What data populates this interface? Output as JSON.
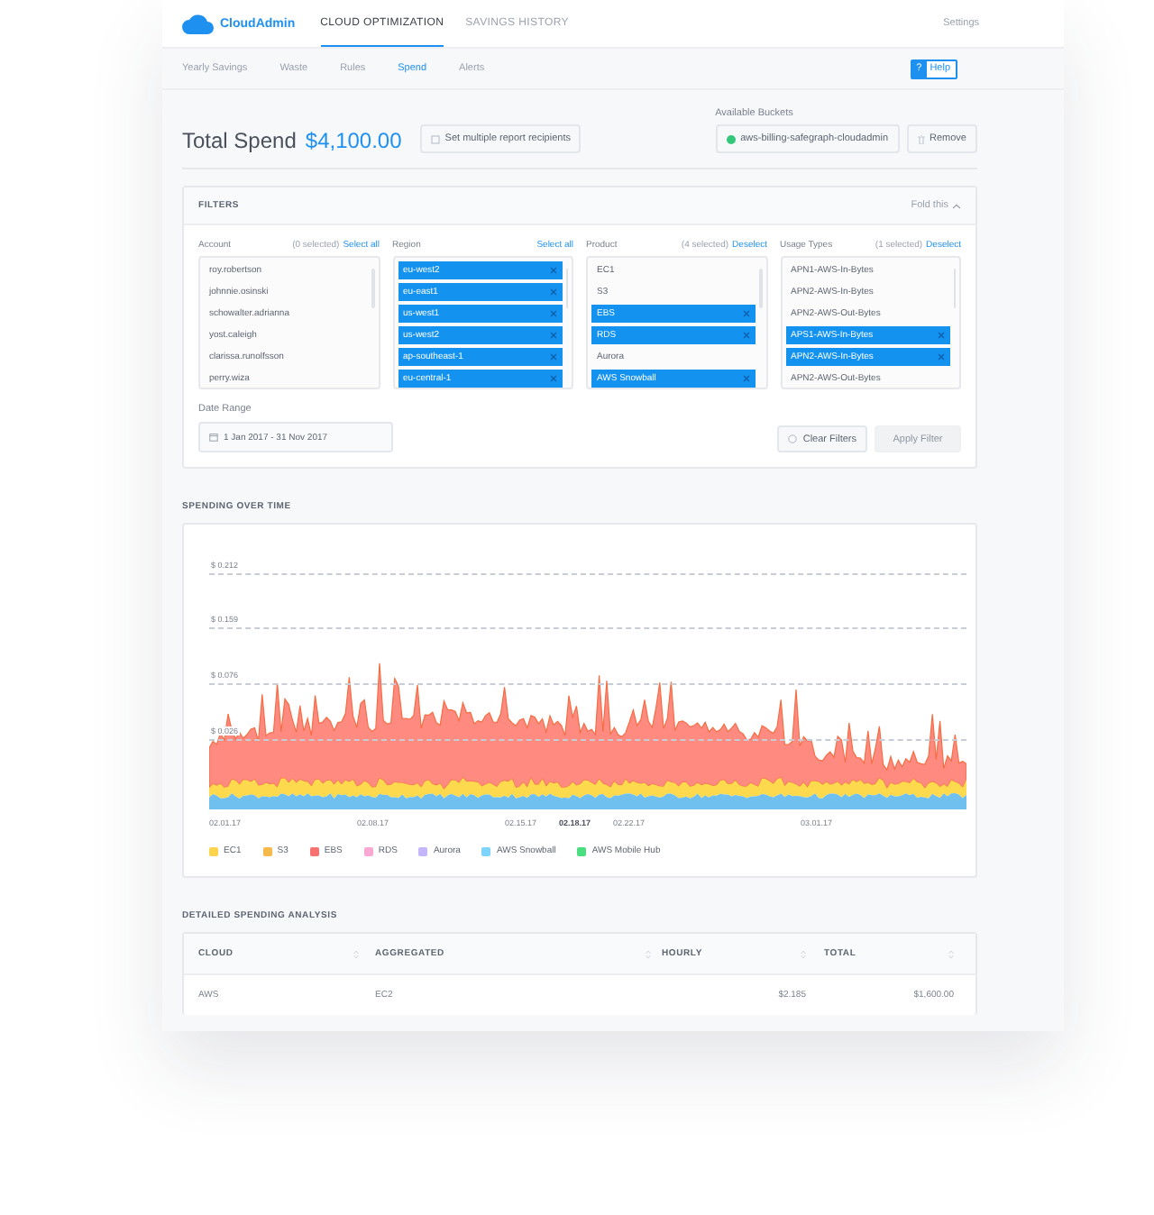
{
  "brand": "CloudAdmin",
  "nav": [
    {
      "label": "CLOUD OPTIMIZATION",
      "selected": true
    },
    {
      "label": "SAVINGS HISTORY",
      "selected": false
    }
  ],
  "settings": "Settings",
  "subnav": [
    {
      "label": "Yearly Savings",
      "selected": false
    },
    {
      "label": "Waste",
      "selected": false
    },
    {
      "label": "Rules",
      "selected": false
    },
    {
      "label": "Spend",
      "selected": true
    },
    {
      "label": "Alerts",
      "selected": false
    }
  ],
  "help": {
    "icon": "?",
    "label": "Help"
  },
  "total": {
    "label": "Total Spend",
    "amount": "$4,100.00"
  },
  "recipients_button": "Set multiple report recipients",
  "buckets": {
    "label": "Available Buckets",
    "bucket": "aws-billing-safegraph-cloudadmin",
    "remove": "Remove"
  },
  "filters": {
    "title": "FILTERS",
    "fold": "Fold this",
    "columns": [
      {
        "label": "Account",
        "count": "(0 selected)",
        "action": "Select all",
        "items": [
          {
            "label": "roy.robertson",
            "selected": false
          },
          {
            "label": "johnnie.osinski",
            "selected": false
          },
          {
            "label": "schowalter.adrianna",
            "selected": false
          },
          {
            "label": "yost.caleigh",
            "selected": false
          },
          {
            "label": "clarissa.runolfsson",
            "selected": false
          },
          {
            "label": "perry.wiza",
            "selected": false
          }
        ]
      },
      {
        "label": "Region",
        "action": "Select all",
        "items": [
          {
            "label": "eu-west2",
            "selected": true
          },
          {
            "label": "eu-east1",
            "selected": true
          },
          {
            "label": "us-west1",
            "selected": true
          },
          {
            "label": "us-west2",
            "selected": true
          },
          {
            "label": "ap-southeast-1",
            "selected": true
          },
          {
            "label": "eu-central-1",
            "selected": true
          }
        ]
      },
      {
        "label": "Product",
        "count": "(4 selected)",
        "action": "Deselect",
        "items": [
          {
            "label": "EC1",
            "selected": false
          },
          {
            "label": "S3",
            "selected": false
          },
          {
            "label": "EBS",
            "selected": true
          },
          {
            "label": "RDS",
            "selected": true
          },
          {
            "label": "Aurora",
            "selected": false
          },
          {
            "label": "AWS Snowball",
            "selected": true
          }
        ]
      },
      {
        "label": "Usage Types",
        "count": "(1 selected)",
        "action": "Deselect",
        "items": [
          {
            "label": "APN1-AWS-In-Bytes",
            "selected": false
          },
          {
            "label": "APN2-AWS-In-Bytes",
            "selected": false
          },
          {
            "label": "APN2-AWS-Out-Bytes",
            "selected": false
          },
          {
            "label": "APS1-AWS-In-Bytes",
            "selected": true
          },
          {
            "label": "APN2-AWS-In-Bytes",
            "selected": true
          },
          {
            "label": "APN2-AWS-Out-Bytes",
            "selected": false
          }
        ]
      }
    ],
    "date_label": "Date Range",
    "date_value": "1 Jan 2017 - 31 Nov 2017",
    "clear": "Clear Filters",
    "apply": {
      "label": "Apply Filter",
      "disabled": true
    }
  },
  "chart": {
    "title": "SPENDING OVER TIME",
    "y_ticks": [
      "$ 0.212",
      "$ 0.159",
      "$ 0.076",
      "$ 0.026"
    ],
    "x_ticks": [
      {
        "label": "02.01.17",
        "highlighted": false
      },
      {
        "label": "02.08.17",
        "highlighted": false
      },
      {
        "label": "02.15.17",
        "highlighted": false
      },
      {
        "label": "02.18.17",
        "highlighted": true
      },
      {
        "label": "02.22.17",
        "highlighted": false
      },
      {
        "label": "03.01.17",
        "highlighted": false
      }
    ],
    "legend": [
      {
        "label": "EC1",
        "color": "#fcd34d"
      },
      {
        "label": "S3",
        "color": "#f6b94a"
      },
      {
        "label": "EBS",
        "color": "#f87171"
      },
      {
        "label": "RDS",
        "color": "#f9a8d4"
      },
      {
        "label": "Aurora",
        "color": "#c4b5fd"
      },
      {
        "label": "AWS Snowball",
        "color": "#7dd3fc"
      },
      {
        "label": "AWS Mobile Hub",
        "color": "#4ade80"
      }
    ]
  },
  "table": {
    "title": "DETAILED SPENDING ANALYSIS",
    "columns": [
      "CLOUD",
      "AGGREGATED",
      "HOURLY",
      "TOTAL"
    ],
    "rows": [
      [
        "AWS",
        "EC2",
        "$2.185",
        "$1,600.00"
      ]
    ]
  }
}
